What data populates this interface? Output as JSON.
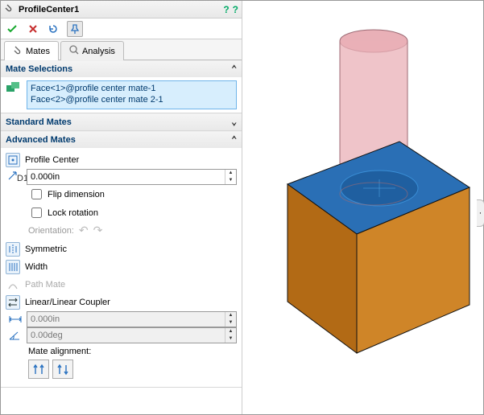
{
  "title": "ProfileCenter1",
  "tabs": {
    "mates": "Mates",
    "analysis": "Analysis"
  },
  "sections": {
    "mateSelections": "Mate Selections",
    "standardMates": "Standard Mates",
    "advancedMates": "Advanced Mates"
  },
  "selections": [
    "Face<1>@profile center mate-1",
    "Face<2>@profile center mate 2-1"
  ],
  "advanced": {
    "profileCenter": "Profile Center",
    "dimValue": "0.000in",
    "flipDimension": "Flip dimension",
    "lockRotation": "Lock rotation",
    "orientation": "Orientation:",
    "symmetric": "Symmetric",
    "width": "Width",
    "pathMate": "Path Mate",
    "linearCoupler": "Linear/Linear Coupler",
    "linValue": "0.000in",
    "angValue": "0.00deg",
    "mateAlignment": "Mate alignment:"
  }
}
